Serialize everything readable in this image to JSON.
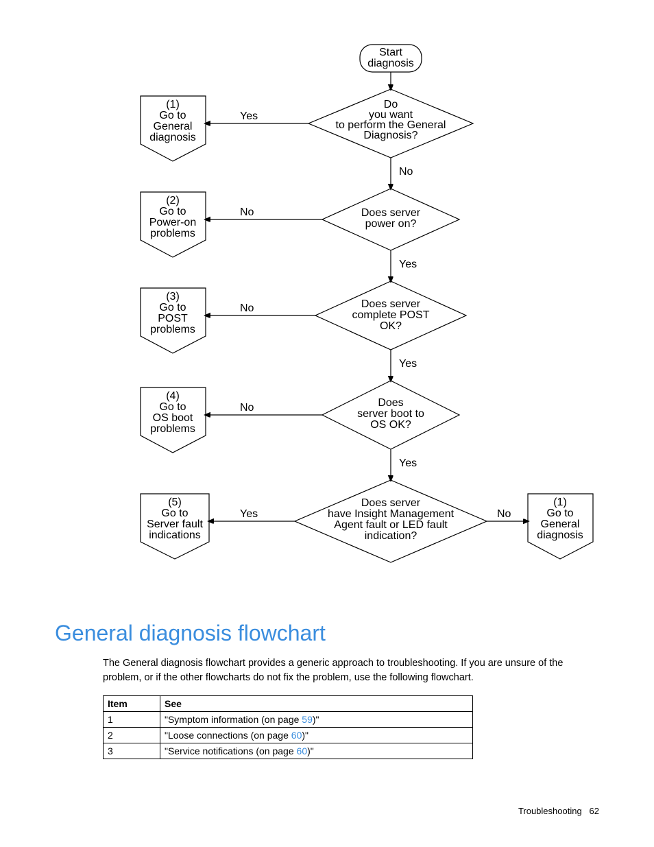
{
  "flowchart": {
    "start": "Start\ndiagnosis",
    "d1": "Do\nyou want\nto perform the General\nDiagnosis?",
    "d2": "Does server\npower on?",
    "d3": "Does server\ncomplete POST\nOK?",
    "d4": "Does\nserver boot to\nOS OK?",
    "d5": "Does server\nhave Insight Management\nAgent fault or LED fault\nindication?",
    "o1": "(1)\nGo to\nGeneral\ndiagnosis",
    "o2": "(2)\nGo to\nPower-on\nproblems",
    "o3": "(3)\nGo to\nPOST\nproblems",
    "o4": "(4)\nGo to\nOS boot\nproblems",
    "o5": "(5)\nGo to\nServer fault\nindications",
    "o6": "(1)\nGo to\nGeneral\ndiagnosis",
    "yes": "Yes",
    "no": "No"
  },
  "section_title": "General diagnosis flowchart",
  "paragraph": "The General diagnosis flowchart provides a generic approach to troubleshooting. If you are unsure of the problem, or if the other flowcharts do not fix the problem, use the following flowchart.",
  "table": {
    "headers": [
      "Item",
      "See"
    ],
    "rows": [
      {
        "item": "1",
        "see_pre": "\"Symptom information (on page ",
        "page": "59",
        "see_post": ")\""
      },
      {
        "item": "2",
        "see_pre": "\"Loose connections (on page ",
        "page": "60",
        "see_post": ")\""
      },
      {
        "item": "3",
        "see_pre": "\"Service notifications (on page ",
        "page": "60",
        "see_post": ")\""
      }
    ]
  },
  "footer": {
    "section": "Troubleshooting",
    "page": "62"
  }
}
